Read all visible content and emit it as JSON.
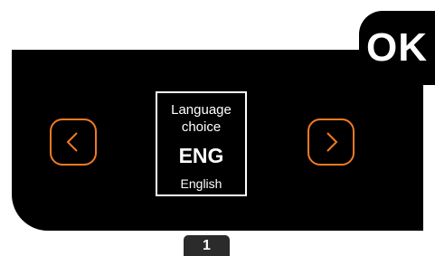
{
  "ok_button": {
    "label": "OK"
  },
  "language_panel": {
    "title": "Language choice",
    "code": "ENG",
    "name": "English"
  },
  "navigation": {
    "prev_icon": "chevron-left-icon",
    "next_icon": "chevron-right-icon"
  },
  "page_indicator": {
    "label": "1"
  },
  "colors": {
    "screen": "#000000",
    "accent": "#f07a24",
    "text": "#ffffff",
    "tab": "#2b2b2b"
  }
}
